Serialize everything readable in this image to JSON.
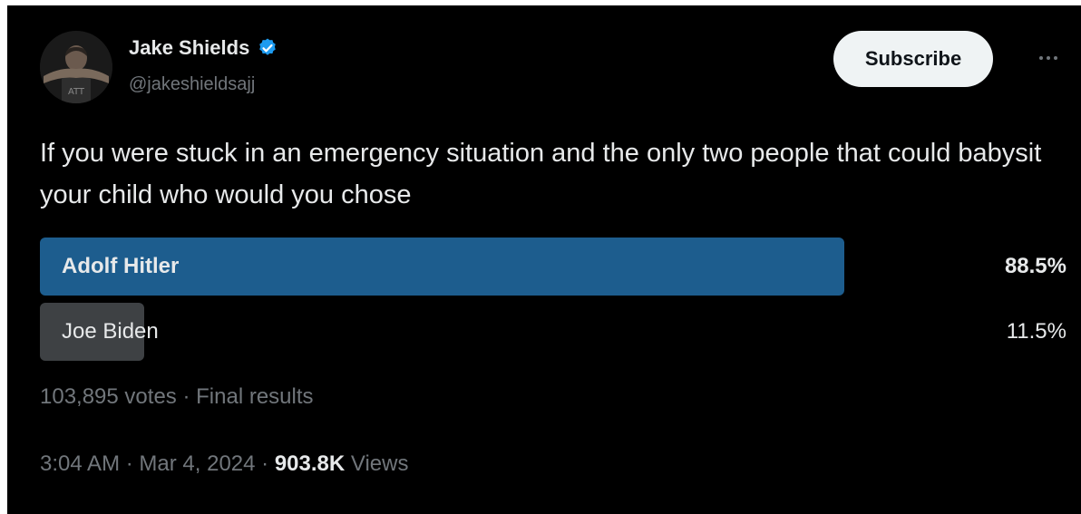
{
  "author": {
    "name": "Jake Shields",
    "handle": "@jakeshieldsajj",
    "verified": true,
    "verified_color": "#1d9bf0"
  },
  "subscribe_label": "Subscribe",
  "more_icon": "more-horizontal-icon",
  "tweet_text": "If you were stuck in an emergency situation and the only two people that could babysit your child who would you chose",
  "poll": {
    "options": [
      {
        "label": "Adolf Hitler",
        "percent_text": "88.5%",
        "percent": 88.5,
        "winner": true
      },
      {
        "label": "Joe Biden",
        "percent_text": "11.5%",
        "percent": 11.5,
        "winner": false
      }
    ],
    "votes_text": "103,895 votes",
    "separator": "·",
    "status_text": "Final results"
  },
  "meta": {
    "time": "3:04 AM",
    "separator": "·",
    "date": "Mar 4, 2024",
    "views_count": "903.8K",
    "views_label": "Views"
  },
  "colors": {
    "background": "#000000",
    "text": "#e7e9ea",
    "muted": "#71767b",
    "winner_bar": "#1d5d8e",
    "loser_bar": "#3e4144"
  }
}
